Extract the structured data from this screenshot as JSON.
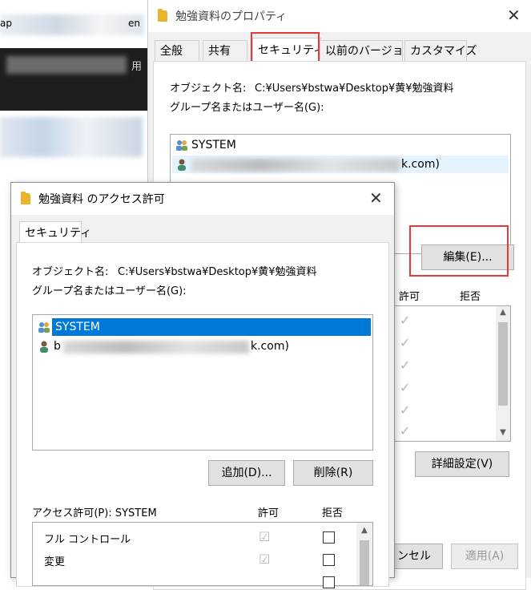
{
  "background_window": {
    "fragments": [
      "ap",
      "en",
      "用"
    ]
  },
  "properties": {
    "title": "勉強資料のプロパティ",
    "tabs": [
      "全般",
      "共有",
      "セキュリティ",
      "以前のバージョン",
      "カスタマイズ"
    ],
    "active_tab": "セキュリティ",
    "object_name_label": "オブジェクト名:",
    "object_name_value": "C:¥Users¥bstwa¥Desktop¥黄¥勉強資料",
    "group_label": "グループ名またはユーザー名(G):",
    "users": [
      {
        "name": "SYSTEM"
      },
      {
        "name": "k.com)"
      }
    ],
    "edit_button": "編集(E)...",
    "perm_allow_header": "許可",
    "perm_deny_header": "拒否",
    "advanced_button": "詳細設定(V)",
    "cancel_button": "ンセル",
    "apply_button": "適用(A)"
  },
  "access": {
    "title": "勉強資料 のアクセス許可",
    "tab": "セキュリティ",
    "object_name_label": "オブジェクト名:",
    "object_name_value": "C:¥Users¥bstwa¥Desktop¥黄¥勉強資料",
    "group_label": "グループ名またはユーザー名(G):",
    "users": [
      {
        "name": "SYSTEM",
        "selected": true
      },
      {
        "name_prefix": "b",
        "name_suffix": "k.com)"
      }
    ],
    "add_button": "追加(D)...",
    "remove_button": "削除(R)",
    "permissions_label": "アクセス許可(P): SYSTEM",
    "allow_header": "許可",
    "deny_header": "拒否",
    "permissions": [
      {
        "name": "フル コントロール"
      },
      {
        "name": "変更"
      }
    ]
  },
  "colors": {
    "selection": "#0078d7",
    "highlight_box": "#e43a3a",
    "folder": "#e8b52a"
  }
}
